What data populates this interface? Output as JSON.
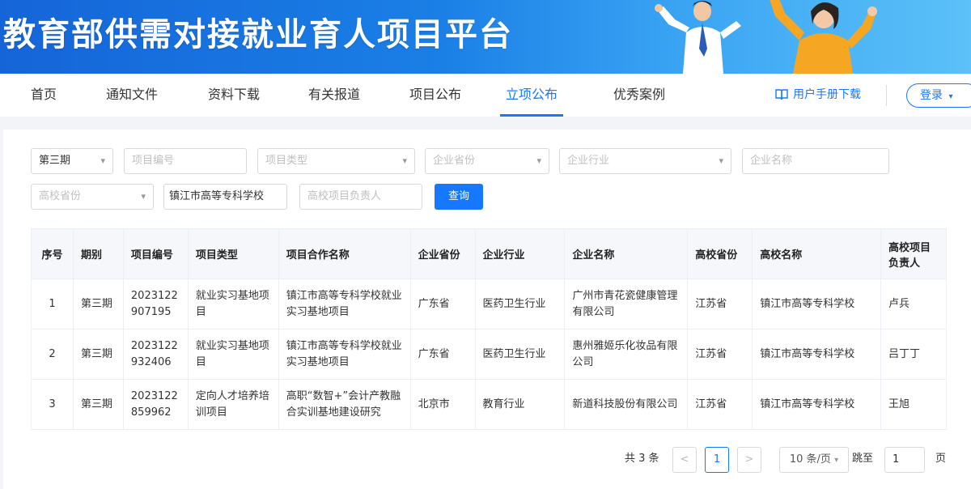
{
  "header": {
    "title": "教育部供需对接就业育人项目平台"
  },
  "nav": {
    "items": [
      "首页",
      "通知文件",
      "资料下载",
      "有关报道",
      "项目公布",
      "立项公布",
      "优秀案例"
    ],
    "active_index": 5,
    "manual_label": "用户手册下载",
    "login_label": "登录"
  },
  "filters": {
    "period_value": "第三期",
    "project_no_placeholder": "项目编号",
    "project_type_placeholder": "项目类型",
    "company_province_placeholder": "企业省份",
    "company_industry_placeholder": "企业行业",
    "company_name_placeholder": "企业名称",
    "college_province_placeholder": "高校省份",
    "college_name_value": "镇江市高等专科学校",
    "college_lead_placeholder": "高校项目负责人",
    "query_label": "查询"
  },
  "table": {
    "columns": [
      "序号",
      "期别",
      "项目编号",
      "项目类型",
      "项目合作名称",
      "企业省份",
      "企业行业",
      "企业名称",
      "高校省份",
      "高校名称",
      "高校项目负责人"
    ],
    "rows": [
      [
        "1",
        "第三期",
        "2023122907195",
        "就业实习基地项目",
        "镇江市高等专科学校就业实习基地项目",
        "广东省",
        "医药卫生行业",
        "广州市青花瓷健康管理有限公司",
        "江苏省",
        "镇江市高等专科学校",
        "卢兵"
      ],
      [
        "2",
        "第三期",
        "2023122932406",
        "就业实习基地项目",
        "镇江市高等专科学校就业实习基地项目",
        "广东省",
        "医药卫生行业",
        "惠州雅姬乐化妆品有限公司",
        "江苏省",
        "镇江市高等专科学校",
        "吕丁丁"
      ],
      [
        "3",
        "第三期",
        "2023122859962",
        "定向人才培养培训项目",
        "高职“数智+”会计产教融合实训基地建设研究",
        "北京市",
        "教育行业",
        "新道科技股份有限公司",
        "江苏省",
        "镇江市高等专科学校",
        "王旭"
      ]
    ]
  },
  "pagination": {
    "total_label": "共 3 条",
    "prev": "<",
    "current_page": "1",
    "next": ">",
    "page_size_label": "10 条/页",
    "jump_label": "跳至",
    "jump_value": "1",
    "page_suffix": "页"
  },
  "colors": {
    "primary": "#1677ff",
    "banner_start": "#1565d8",
    "banner_end": "#5cc1f8"
  }
}
